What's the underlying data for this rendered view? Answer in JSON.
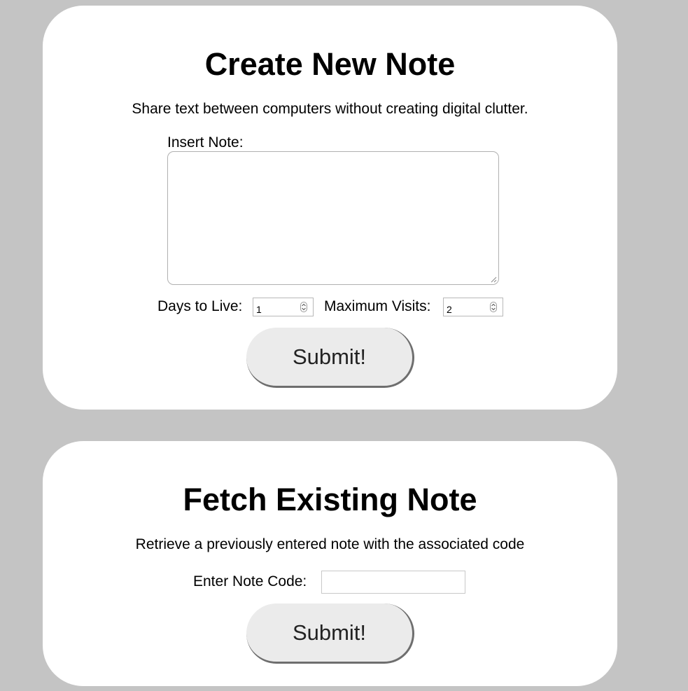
{
  "create_note": {
    "title": "Create New Note",
    "subtitle": "Share text between computers without creating digital clutter.",
    "insert_label": "Insert Note:",
    "note_value": "",
    "days_label": "Days to Live:",
    "days_value": "1",
    "visits_label": "Maximum Visits:",
    "visits_value": "2",
    "submit_label": "Submit!"
  },
  "fetch_note": {
    "title": "Fetch Existing Note",
    "subtitle": "Retrieve a previously entered note with the associated code",
    "code_label": "Enter Note Code:",
    "code_value": "",
    "submit_label": "Submit!"
  },
  "icons": {
    "resize": "resize-grip-icon",
    "spinner": "spinner-arrows-icon"
  },
  "colors": {
    "page_background": "#c4c4c4",
    "card_background": "#ffffff",
    "button_background": "#ebebeb",
    "button_shadow": "#6e6e6e"
  }
}
